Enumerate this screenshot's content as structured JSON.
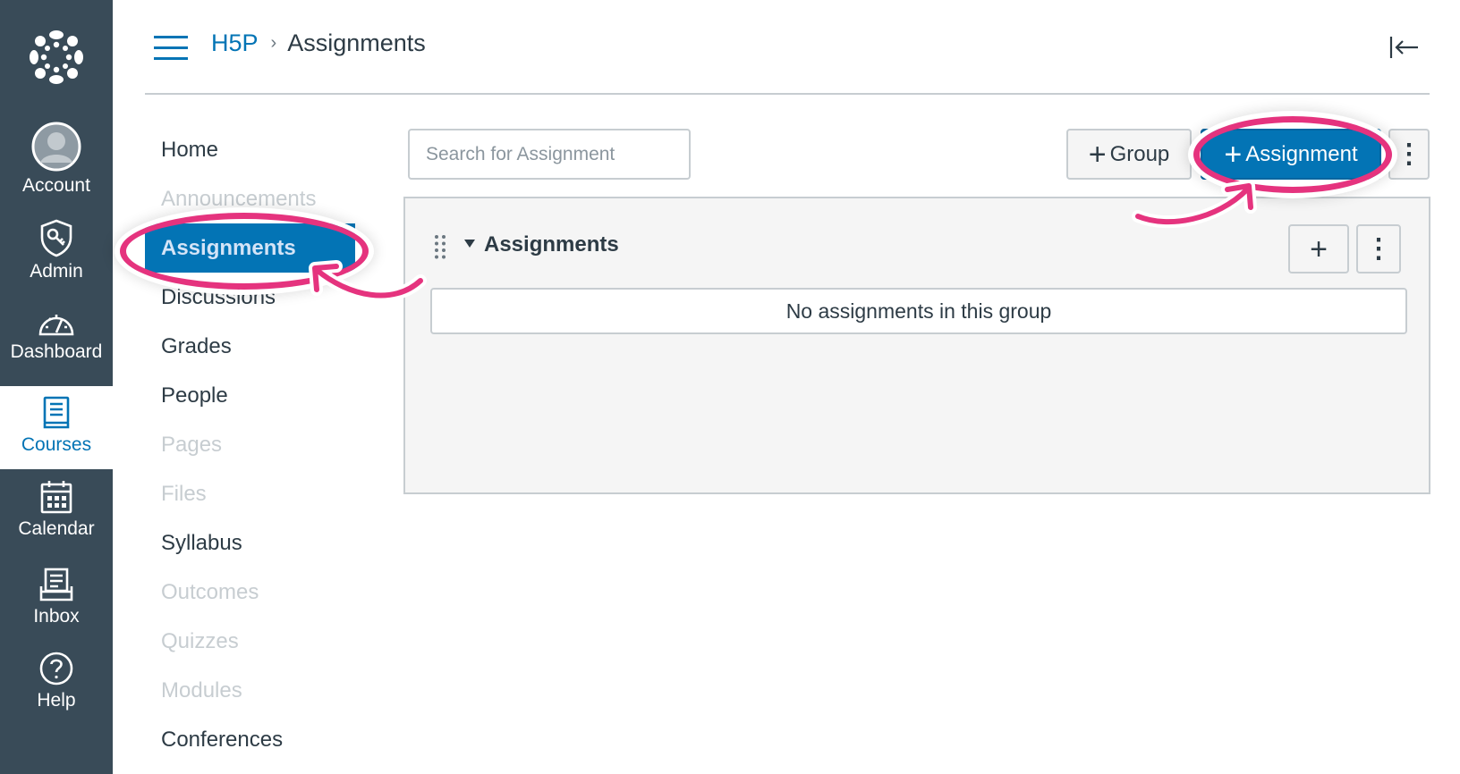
{
  "global_nav": {
    "items": [
      {
        "label": "Account",
        "icon": "account-avatar-icon"
      },
      {
        "label": "Admin",
        "icon": "admin-shield-icon"
      },
      {
        "label": "Dashboard",
        "icon": "dashboard-gauge-icon"
      },
      {
        "label": "Courses",
        "icon": "courses-book-icon",
        "active": true
      },
      {
        "label": "Calendar",
        "icon": "calendar-icon"
      },
      {
        "label": "Inbox",
        "icon": "inbox-icon"
      },
      {
        "label": "Help",
        "icon": "help-circle-icon"
      }
    ],
    "colors": {
      "background": "#394b58",
      "active_text": "#0374b5"
    }
  },
  "header": {
    "breadcrumb": {
      "course": "H5P",
      "current": "Assignments"
    }
  },
  "course_nav": {
    "items": [
      {
        "label": "Home",
        "state": "enabled"
      },
      {
        "label": "Announcements",
        "state": "disabled"
      },
      {
        "label": "Assignments",
        "state": "active"
      },
      {
        "label": "Discussions",
        "state": "enabled"
      },
      {
        "label": "Grades",
        "state": "enabled"
      },
      {
        "label": "People",
        "state": "enabled"
      },
      {
        "label": "Pages",
        "state": "disabled"
      },
      {
        "label": "Files",
        "state": "disabled"
      },
      {
        "label": "Syllabus",
        "state": "enabled"
      },
      {
        "label": "Outcomes",
        "state": "disabled"
      },
      {
        "label": "Quizzes",
        "state": "disabled"
      },
      {
        "label": "Modules",
        "state": "disabled"
      },
      {
        "label": "Conferences",
        "state": "enabled"
      }
    ]
  },
  "toolbar": {
    "search_placeholder": "Search for Assignment",
    "search_value": "",
    "group_button": "Group",
    "assignment_button": "Assignment",
    "plus_glyph": "+",
    "more_glyph": "⋮"
  },
  "assignment_group": {
    "title": "Assignments",
    "empty_message": "No assignments in this group",
    "add_glyph": "+",
    "more_glyph": "⋮"
  },
  "colors": {
    "accent": "#0374b5",
    "annotation": "#e5337e",
    "panel_bg": "#f5f5f5",
    "border": "#c7cdd1"
  }
}
